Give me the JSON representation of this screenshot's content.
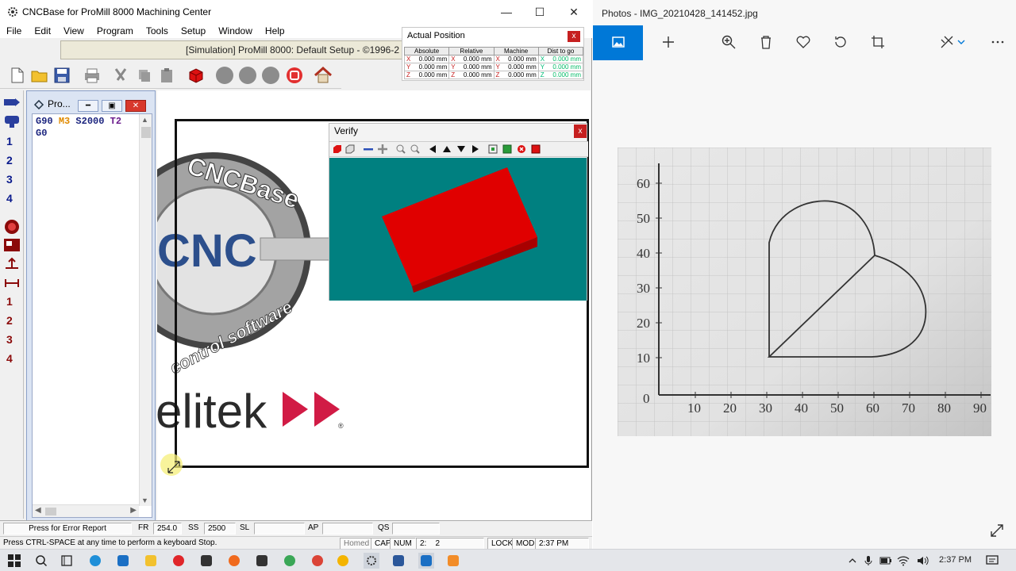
{
  "cnc": {
    "title": "CNCBase for ProMill 8000 Machining Center",
    "menu": [
      "File",
      "Edit",
      "View",
      "Program",
      "Tools",
      "Setup",
      "Window",
      "Help"
    ],
    "sim_banner": "[Simulation] ProMill 8000: Default Setup - ©1996-2",
    "actual_position": {
      "title": "Actual Position",
      "close": "x",
      "columns": [
        "Absolute",
        "Relative",
        "Machine",
        "Dist to go"
      ],
      "rows": [
        {
          "abs_axis": "X",
          "abs": "0.000 mm",
          "rel_axis": "X",
          "rel": "0.000 mm",
          "mac_axis": "X",
          "mac": "0.000 mm",
          "dtg_axis": "X",
          "dtg": "0.000 mm"
        },
        {
          "abs_axis": "Y",
          "abs": "0.000 mm",
          "rel_axis": "Y",
          "rel": "0.000 mm",
          "mac_axis": "Y",
          "mac": "0.000 mm",
          "dtg_axis": "Y",
          "dtg": "0.000 mm"
        },
        {
          "abs_axis": "Z",
          "abs": "0.000 mm",
          "rel_axis": "Z",
          "rel": "0.000 mm",
          "mac_axis": "Z",
          "mac": "0.000 mm",
          "dtg_axis": "Z",
          "dtg": "0.000 mm"
        }
      ]
    },
    "vstrip_numbers_top": [
      "1",
      "2",
      "3",
      "4"
    ],
    "vstrip_numbers_bottom": [
      "1",
      "2",
      "3",
      "4"
    ],
    "program": {
      "title": "Pro...",
      "line1": {
        "g": "G90",
        "m": "M3",
        "s": "S2000",
        "t": "T2"
      },
      "line2": "G0"
    },
    "verify": {
      "title": "Verify",
      "close": "x"
    },
    "logo": {
      "brand": "CNCBase",
      "cnc": "CNC",
      "tagline": "control software",
      "company": "elitek",
      "reg": "®"
    },
    "status1": {
      "error_report": "Press for Error Report",
      "fr_label": "FR",
      "fr_value": "254.0",
      "ss_label": "SS",
      "ss_value": "2500",
      "sl_label": "SL",
      "ap_label": "AP",
      "qs_label": "QS"
    },
    "status2": {
      "hint": "Press CTRL-SPACE at any time to perform a keyboard Stop.",
      "homed": "Homed",
      "cap": "CAP",
      "num": "NUM",
      "pos": "2:    2",
      "lock": "LOCK",
      "mod": "MOD",
      "time": "2:37 PM"
    }
  },
  "photos": {
    "title": "Photos - IMG_20210428_141452.jpg",
    "graph": {
      "y_ticks": [
        "10",
        "20",
        "30",
        "40",
        "50",
        "60"
      ],
      "x_ticks": [
        "10",
        "20",
        "30",
        "40",
        "50",
        "60",
        "70",
        "80",
        "90"
      ],
      "origin": "0"
    }
  },
  "taskbar": {
    "time": "2:37 PM"
  }
}
